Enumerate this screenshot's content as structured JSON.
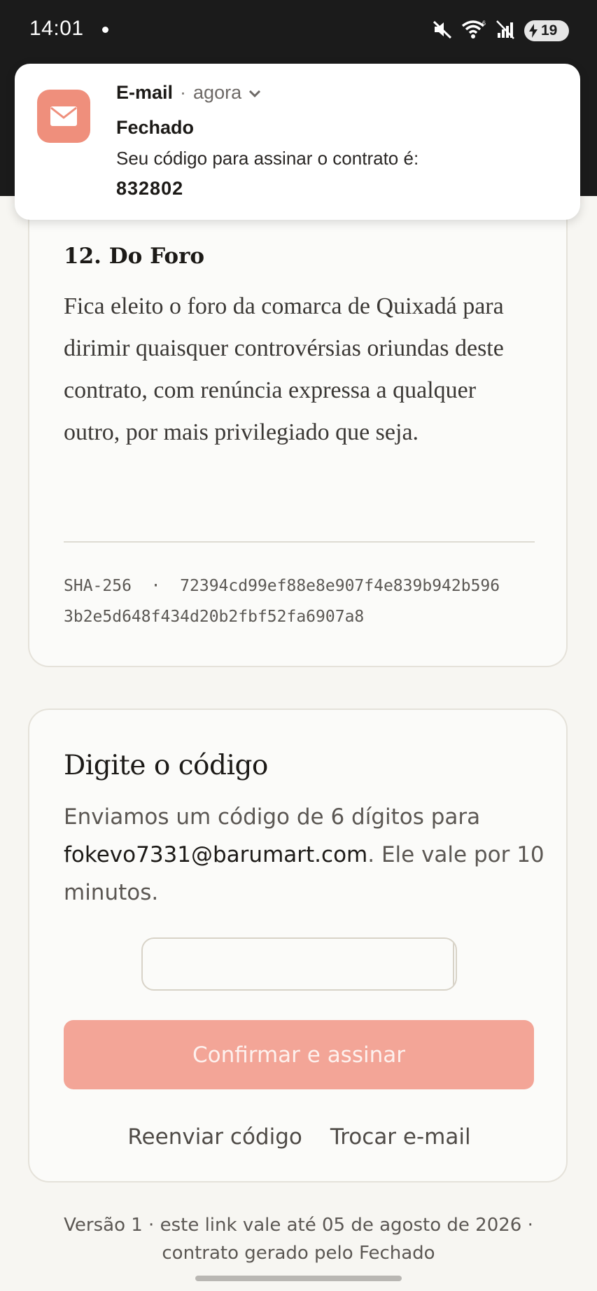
{
  "status_bar": {
    "time": "14:01",
    "battery": "19",
    "icons": [
      "mute-icon",
      "wifi-icon",
      "no-signal-icon",
      "battery-icon"
    ]
  },
  "notification": {
    "app": "E-mail",
    "separator": "·",
    "time": "agora",
    "title": "Fechado",
    "body": "Seu código para assinar o contrato é:",
    "code": "832802",
    "accent_color": "#ef8f7c"
  },
  "contract": {
    "clause_title": "12. Do Foro",
    "clause_text": "Fica eleito o foro da comarca de Quixadá para dirimir quaisquer controvérsias oriundas deste contrato, com renúncia expressa a qualquer outro, por mais privilegiado que seja.",
    "hash_line1": "SHA-256  ·  72394cd99ef88e8e907f4e839b942b596",
    "hash_line2": "3b2e5d648f434d20b2fbf52fa6907a8"
  },
  "code_entry": {
    "title": "Digite o código",
    "desc_prefix": "Enviamos um código de 6 dígitos para",
    "email": "fokevo7331@barumart.com",
    "desc_suffix": ". Ele vale por 10 minutos.",
    "confirm_label": "Confirmar e assinar",
    "resend_label": "Reenviar código",
    "change_email_label": "Trocar e-mail",
    "button_color": "#f3a597"
  },
  "footer": {
    "line1": "Versão 1 · este link vale até 05 de agosto de 2026 ·",
    "line2": "contrato gerado pelo Fechado"
  }
}
